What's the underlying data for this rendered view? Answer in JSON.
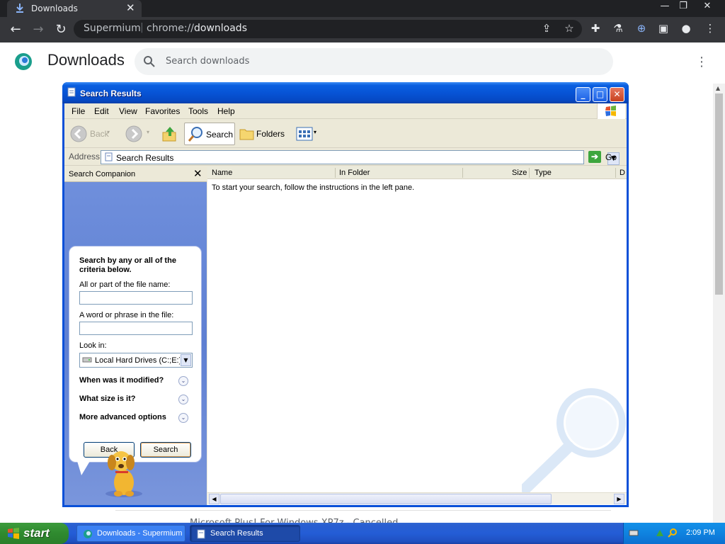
{
  "browser": {
    "tab_title": "Downloads",
    "site_label": "Supermium",
    "url_scheme": "chrome://",
    "url_path": "downloads"
  },
  "downloads_page": {
    "title": "Downloads",
    "search_placeholder": "Search downloads",
    "item_peek": "Microsoft Plus! For Windows XP7z - Cancelled"
  },
  "xp_window": {
    "title": "Search Results",
    "menu": [
      "File",
      "Edit",
      "View",
      "Favorites",
      "Tools",
      "Help"
    ],
    "toolbar": {
      "back": "Back",
      "search": "Search",
      "folders": "Folders"
    },
    "address_label": "Address",
    "address_value": "Search Results",
    "go_label": "Go",
    "companion": {
      "header": "Search Companion",
      "heading": "Search by any or all of the criteria below.",
      "file_name_label": "All or part of the file name:",
      "file_name_value": "",
      "phrase_label": "A word or phrase in the file:",
      "phrase_value": "",
      "look_in_label": "Look in:",
      "look_in_value": "Local Hard Drives (C:;E:)",
      "when_modified": "When was it modified?",
      "what_size": "What size is it?",
      "advanced": "More advanced options",
      "back_button": "Back",
      "search_button": "Search"
    },
    "results": {
      "columns": [
        "Name",
        "In Folder",
        "Size",
        "Type",
        "D"
      ],
      "message": "To start your search, follow the instructions in the left pane."
    }
  },
  "taskbar": {
    "start_label": "start",
    "items": [
      {
        "label": "Downloads - Supermium"
      },
      {
        "label": "Search Results"
      }
    ],
    "clock": "2:09 PM"
  },
  "colors": {
    "chrome_dark": "#202124",
    "xp_blue": "#0a50d8",
    "companion_blue": "#6b8ad8",
    "taskbar_blue": "#245dd6",
    "start_green": "#2f8a2f"
  }
}
